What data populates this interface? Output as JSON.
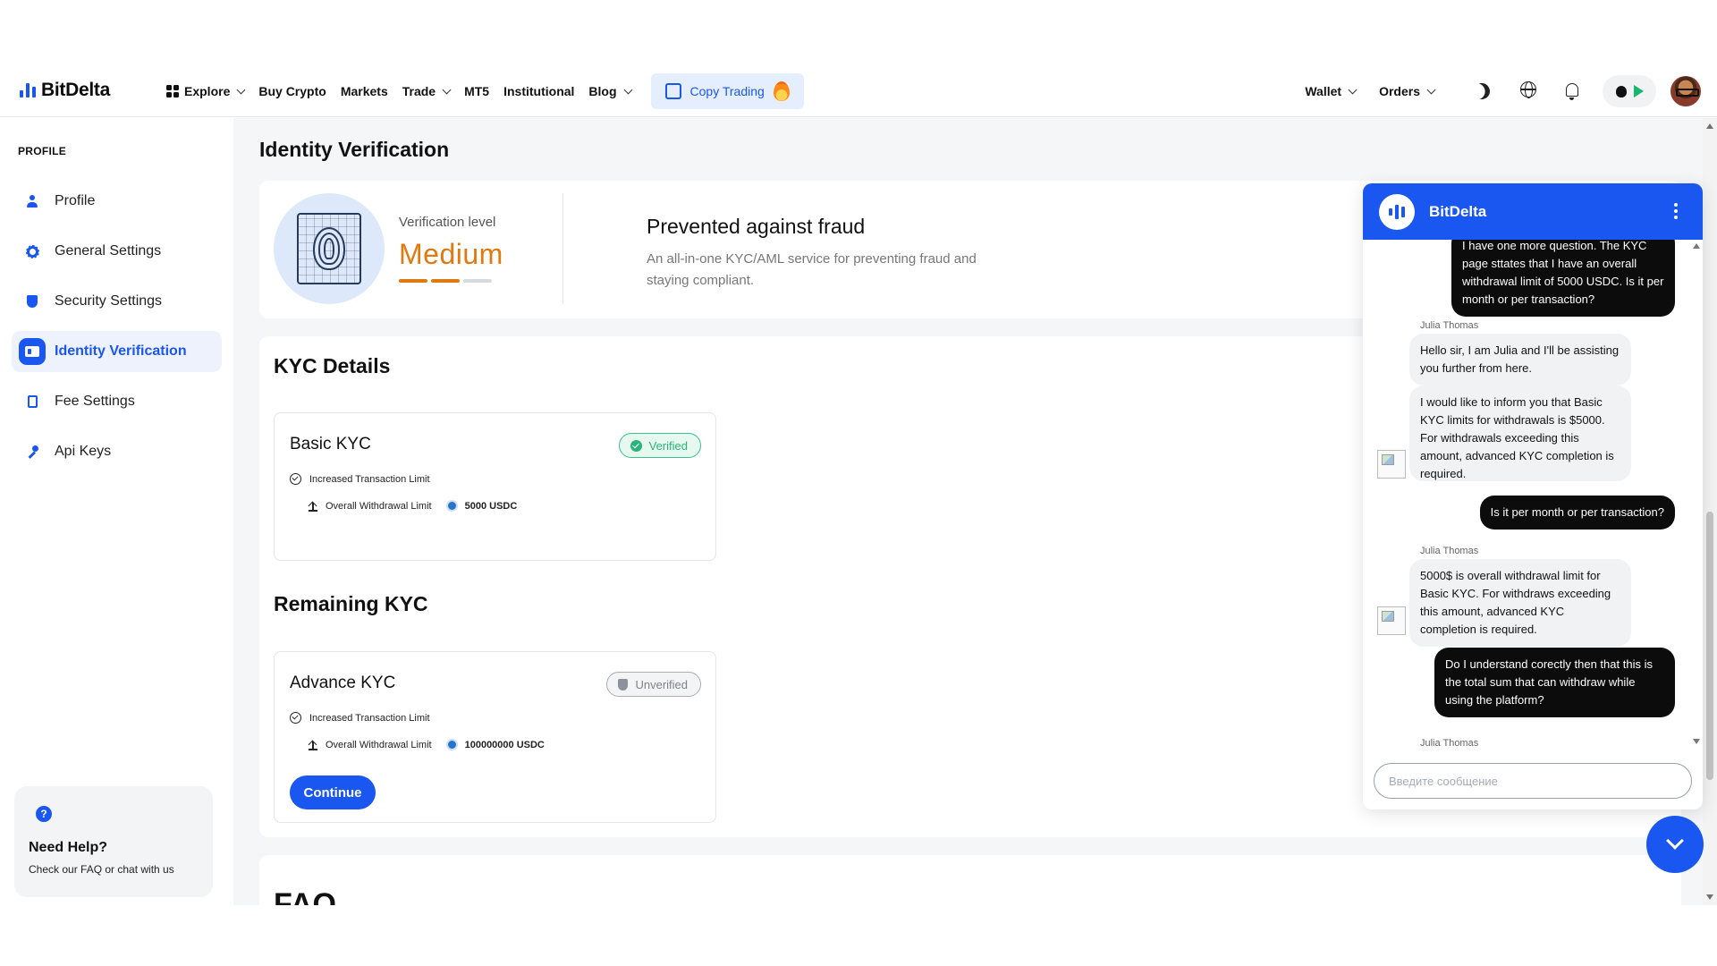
{
  "brand": {
    "name": "BitDelta",
    "accent": "#1a56f0"
  },
  "nav": {
    "explore": "Explore",
    "buy_crypto": "Buy Crypto",
    "markets": "Markets",
    "trade": "Trade",
    "mt5": "MT5",
    "institutional": "Institutional",
    "blog": "Blog",
    "copy_trading": "Copy Trading",
    "wallet": "Wallet",
    "orders": "Orders"
  },
  "sidebar": {
    "section": "PROFILE",
    "items": [
      {
        "label": "Profile",
        "icon": "person-icon"
      },
      {
        "label": "General Settings",
        "icon": "gear-icon"
      },
      {
        "label": "Security Settings",
        "icon": "shield-icon"
      },
      {
        "label": "Identity Verification",
        "icon": "id-card-icon",
        "active": true
      },
      {
        "label": "Fee Settings",
        "icon": "document-icon"
      },
      {
        "label": "Api Keys",
        "icon": "key-icon"
      }
    ],
    "help": {
      "title": "Need Help?",
      "subtitle": "Check our FAQ or chat with us"
    }
  },
  "main": {
    "title": "Identity Verification",
    "level": {
      "label": "Verification level",
      "value": "Medium",
      "progress_steps_filled": 2,
      "progress_steps_total": 3,
      "colors": {
        "filled": "#e07a10",
        "empty": "#d5d9e0"
      }
    },
    "fraud": {
      "title": "Prevented against fraud",
      "subtitle": "An all-in-one KYC/AML service for preventing fraud and staying compliant."
    },
    "kyc_details": {
      "title": "KYC Details",
      "basic": {
        "title": "Basic KYC",
        "status": "Verified",
        "feature": "Increased Transaction Limit",
        "withdrawal_label": "Overall Withdrawal Limit",
        "withdrawal_value": "5000 USDC"
      }
    },
    "remaining_kyc": {
      "title": "Remaining KYC",
      "advance": {
        "title": "Advance KYC",
        "status": "Unverified",
        "feature": "Increased Transaction Limit",
        "withdrawal_label": "Overall Withdrawal Limit",
        "withdrawal_value": "100000000 USDC",
        "button": "Continue"
      }
    },
    "faq_title": "FAQ"
  },
  "chat": {
    "title": "BitDelta",
    "messages": [
      {
        "from": "user",
        "text": "I have one more question. The KYC page sttates that I have an overall withdrawal limit of 5000 USDC. Is it per month or per transaction?"
      },
      {
        "from": "agent",
        "name": "Julia Thomas",
        "text": "Hello sir, I am Julia and I'll be assisting you further from here."
      },
      {
        "from": "agent",
        "text": "I would like to inform you that Basic KYC limits for withdrawals is $5000. For withdrawals exceeding this amount, advanced KYC completion is required."
      },
      {
        "from": "user",
        "text": "Is it per month or per transaction?"
      },
      {
        "from": "agent",
        "name": "Julia Thomas",
        "text": "5000$ is overall withdrawal limit for Basic KYC. For withdraws exceeding this amount, advanced KYC completion is required."
      },
      {
        "from": "user",
        "text": "Do I understand corectly then that this is the total sum that can withdraw while using the platform?"
      },
      {
        "from": "agent",
        "name": "Julia Thomas"
      }
    ],
    "input_placeholder": "Введите сообщение"
  }
}
